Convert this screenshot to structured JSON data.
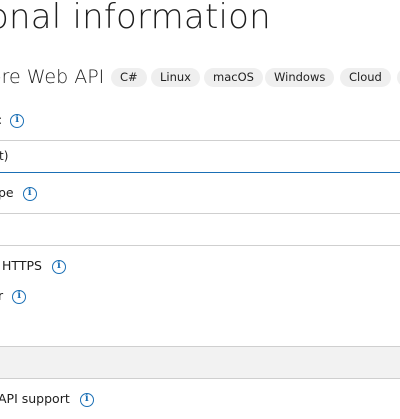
{
  "page": {
    "title": "onal information",
    "project_type": "ore Web API",
    "tags": [
      "C#",
      "Linux",
      "macOS",
      "Windows",
      "Cloud"
    ],
    "framework": {
      "label": ":",
      "value": "t)"
    },
    "auth_type": {
      "label": "pe",
      "value": ""
    },
    "https": {
      "label": "HTTPS"
    },
    "docker": {
      "label": "r"
    },
    "docker_os": {
      "value": ""
    },
    "openapi": {
      "label": "API support"
    }
  },
  "colors": {
    "accent": "#1a6fb5",
    "tag_bg": "#efefef",
    "disabled_bg": "#f2f2f2"
  }
}
